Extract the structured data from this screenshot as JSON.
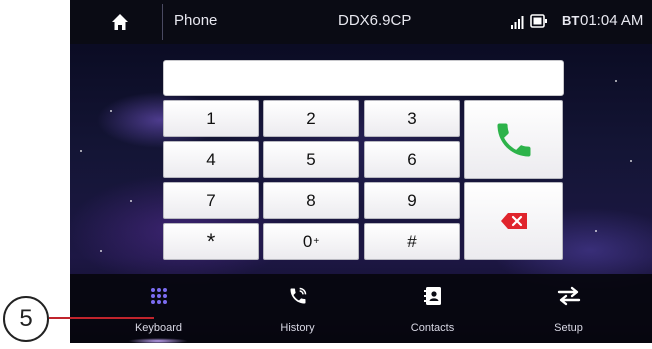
{
  "statusbar": {
    "title": "Phone",
    "device": "DDX6.9CP",
    "bt": "BT",
    "time": "01:04 AM"
  },
  "dial_display": {
    "value": ""
  },
  "keypad": {
    "k1": "1",
    "k2": "2",
    "k3": "3",
    "k4": "4",
    "k5": "5",
    "k6": "6",
    "k7": "7",
    "k8": "8",
    "k9": "9",
    "star": "*",
    "zero": "0",
    "zero_sup": "+",
    "hash": "#"
  },
  "nav": {
    "keyboard": "Keyboard",
    "history": "History",
    "contacts": "Contacts",
    "setup": "Setup"
  },
  "callout": {
    "number": "5"
  },
  "icons": {
    "home": "home-icon",
    "signal": "signal-strength-icon",
    "phone_status": "phone-connected-icon",
    "call": "phone-call-icon",
    "backspace": "backspace-icon",
    "keyboard": "keypad-grid-icon",
    "history": "call-history-icon",
    "contacts": "contacts-book-icon",
    "setup": "setup-arrows-icon"
  },
  "colors": {
    "call_green": "#2db34a",
    "delete_red": "#e0242c",
    "keypad_icon": "#7b6cf0",
    "callout_line": "#c0242c"
  }
}
